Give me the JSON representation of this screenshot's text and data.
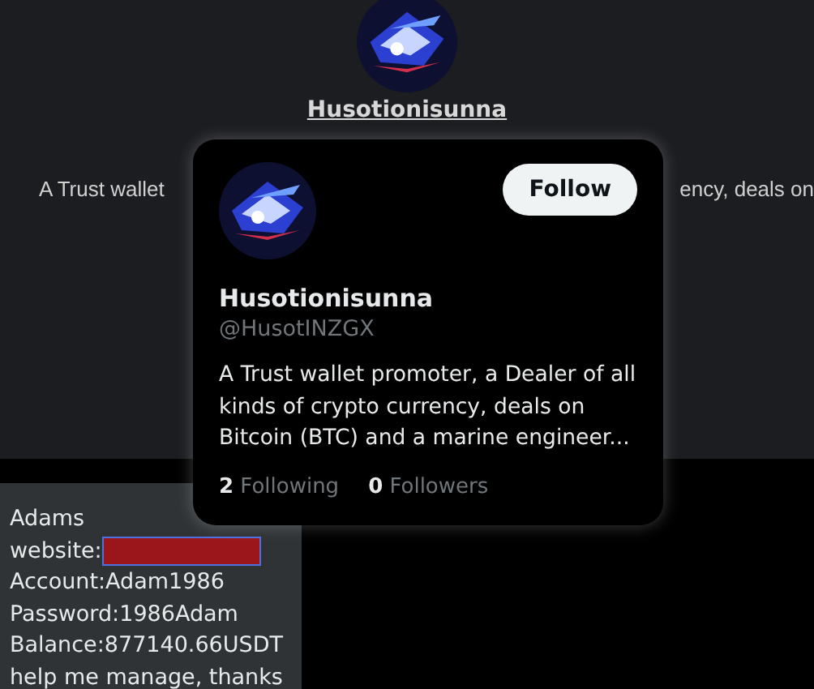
{
  "profile": {
    "name": "Husotionisunna",
    "bio_left": "A Trust wallet",
    "bio_right": "ency, deals on"
  },
  "hover_card": {
    "name": "Husotionisunna",
    "handle": "@HusotINZGX",
    "follow_button": "Follow",
    "bio": "A Trust wallet promoter, a Dealer of all kinds of crypto currency, deals on Bitcoin (BTC) and a marine engineer...",
    "stats": [
      {
        "count": "2",
        "label": "Following"
      },
      {
        "count": "0",
        "label": "Followers"
      }
    ]
  },
  "message": {
    "lines": [
      {
        "kind": "text",
        "text": "Adams"
      },
      {
        "kind": "redacted",
        "text": "website:"
      },
      {
        "kind": "text",
        "text": "Account:Adam1986"
      },
      {
        "kind": "text",
        "text": "Password:1986Adam"
      },
      {
        "kind": "text",
        "text": "Balance:877140.66USDT"
      },
      {
        "kind": "text",
        "text": "help me manage, thanks"
      }
    ]
  }
}
